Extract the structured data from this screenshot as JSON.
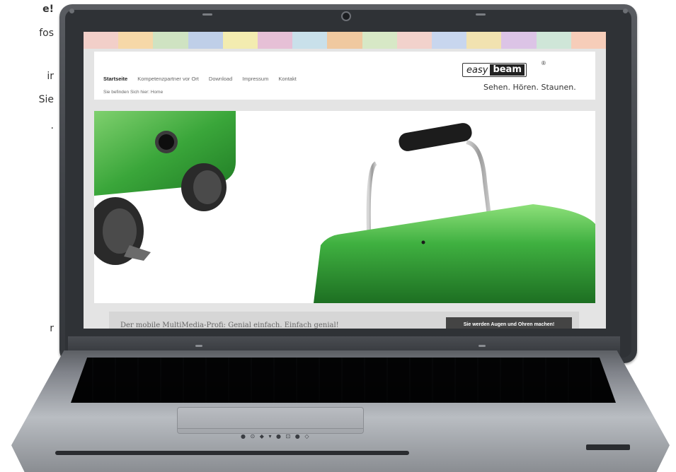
{
  "left_text": [
    {
      "text": "e!",
      "bold": true
    },
    {
      "text": "fos",
      "bold": false
    },
    {
      "text": "ir",
      "bold": false
    },
    {
      "text": "Sie",
      "bold": false
    },
    {
      "text": ".",
      "bold": false
    },
    {
      "text": "r",
      "bold": false
    }
  ],
  "website": {
    "nav": [
      "Startseite",
      "Kompetenzpartner vor Ort",
      "Download",
      "Impressum",
      "Kontakt"
    ],
    "breadcrumb": "Sie befinden Sich hier: Home",
    "logo": {
      "easy": "easy",
      "beam": "beam",
      "registered": "®"
    },
    "tagline": "Sehen. Hören. Staunen.",
    "teaser_text": "Der mobile MultiMedia-Profi: Genial einfach. Einfach genial!",
    "teaser_button": "Sie werden Augen und Ohren machen!"
  },
  "laptop": {
    "indicators": "● ⊙ ◆ ▾ ● ⊡ ● ◇"
  },
  "colors": {
    "strip": [
      "#f2cfc9",
      "#f6d8a8",
      "#cfe3c2",
      "#bfcfe8",
      "#f3ecb0",
      "#e6c0d6",
      "#c9e0ea",
      "#f0c9a0",
      "#d7e8c6",
      "#f2d2cc",
      "#c8d6ee",
      "#f1e2b0",
      "#dcc4e6",
      "#cfe6d8",
      "#f6cdb9"
    ],
    "product_green": "#3aa63a",
    "site_button": "#444444"
  }
}
